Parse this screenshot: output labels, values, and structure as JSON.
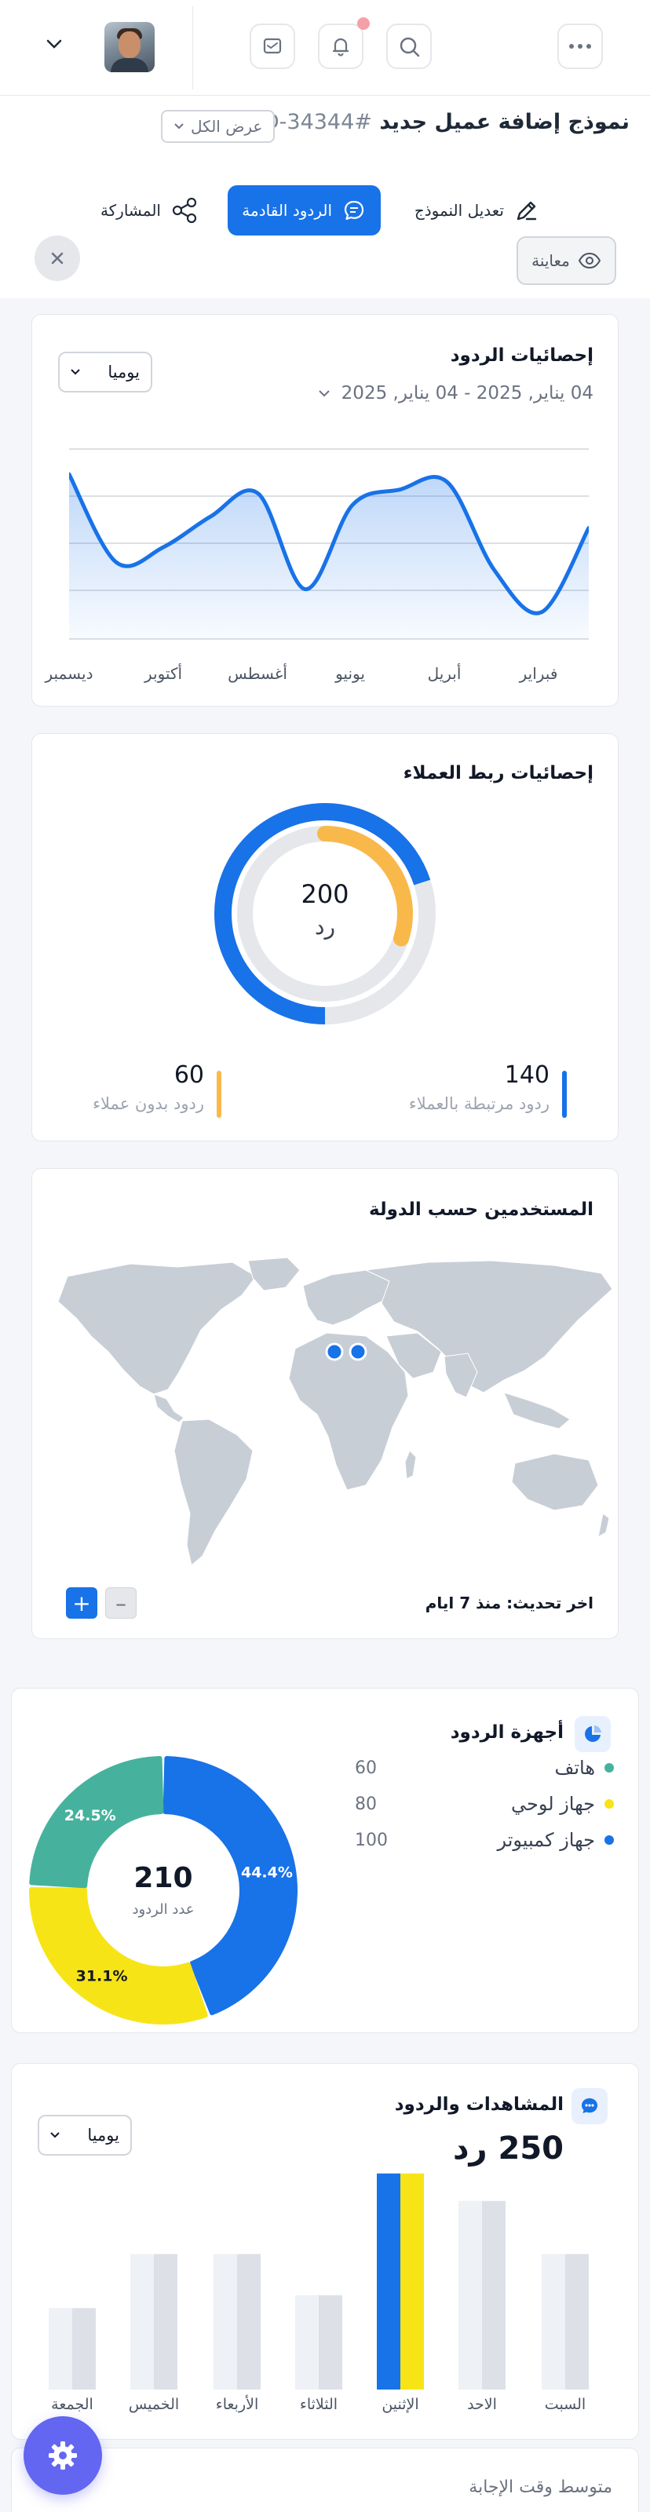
{
  "header": {
    "notification_dot_color": "#f5a0a7"
  },
  "page": {
    "title": "نموذج إضافة عميل جديد",
    "id": "ID-34344#",
    "view_all": "عرض الكل"
  },
  "tabs": [
    {
      "label": "تعديل النموذج",
      "icon": "pencil-icon"
    },
    {
      "label": "الردود القادمة",
      "icon": "chat-icon"
    },
    {
      "label": "المشاركة",
      "icon": "share-icon"
    }
  ],
  "preview_label": "معاينة",
  "responses_stats": {
    "title": "إحصائيات الردود",
    "period_select": "يوميا",
    "date_range": "04 يناير, 2025 - 04 يناير, 2025",
    "months": [
      "فبراير",
      "أبريل",
      "يونيو",
      "أغسطس",
      "أكتوبر",
      "ديسمبر"
    ],
    "chart_data": {
      "type": "area",
      "x": [
        "فبراير",
        "أبريل",
        "يونيو",
        "أغسطس",
        "أكتوبر",
        "ديسمبر"
      ],
      "series": [
        {
          "values": [
            4.3,
            2.0,
            2.4,
            3.2,
            3.8,
            1.3,
            3.5,
            3.9,
            4.1,
            1.8,
            0.7,
            2.9
          ]
        }
      ],
      "color": "#1872e8"
    }
  },
  "clients_stats": {
    "title": "إحصائيات ربط العملاء",
    "total": "200",
    "unit": "رد",
    "linked_count": "140",
    "linked_label": "ردود مرتبطة بالعملاء",
    "unlinked_count": "60",
    "unlinked_label": "ردود بدون عملاء",
    "colors": {
      "linked": "#1872e8",
      "unlinked": "#f8b94a"
    },
    "chart_data": {
      "type": "pie",
      "categories": [
        "ردود مرتبطة بالعملاء",
        "ردود بدون عملاء"
      ],
      "values": [
        140,
        60
      ]
    }
  },
  "users_by_country": {
    "title": "المستخدمين حسب الدولة",
    "last_update": "اخر تحديث: منذ 7 ايام"
  },
  "devices": {
    "title": "أجهزة الردود",
    "total": "210",
    "total_label": "عدد الردود",
    "items": [
      {
        "name": "هاتف",
        "value": "60",
        "color": "#46b29d",
        "pct": "24.5%"
      },
      {
        "name": "جهاز لوحي",
        "value": "80",
        "color": "#f7e417",
        "pct": "31.1%"
      },
      {
        "name": "جهاز كمبيوتر",
        "value": "100",
        "color": "#1872e8",
        "pct": "44.4%"
      }
    ],
    "chart_data": {
      "type": "pie",
      "categories": [
        "جهاز كمبيوتر",
        "جهاز لوحي",
        "هاتف"
      ],
      "values": [
        44.4,
        31.1,
        24.5
      ]
    }
  },
  "views": {
    "title": "المشاهدات والردود",
    "total": "250 رد",
    "period_select": "يوميا",
    "days": [
      "السبت",
      "الاحد",
      "الإثنين",
      "الثلاثاء",
      "الأربعاء",
      "الخميس",
      "الجمعة"
    ],
    "chart_data": {
      "type": "bar",
      "categories": [
        "السبت",
        "الاحد",
        "الإثنين",
        "الثلاثاء",
        "الأربعاء",
        "الخميس",
        "الجمعة"
      ],
      "series": [
        {
          "values": [
            158,
            220,
            252,
            110,
            158,
            158,
            95
          ]
        },
        {
          "values": [
            158,
            220,
            252,
            110,
            158,
            158,
            95
          ]
        }
      ],
      "highlight_index": 2,
      "colors": {
        "bar": "#dde1e7",
        "bar_light": "#eef1f5",
        "highlight_a": "#1872e8",
        "highlight_b": "#f7e417"
      }
    }
  },
  "avg_response": {
    "title": "متوسط وقت الإجابة"
  }
}
